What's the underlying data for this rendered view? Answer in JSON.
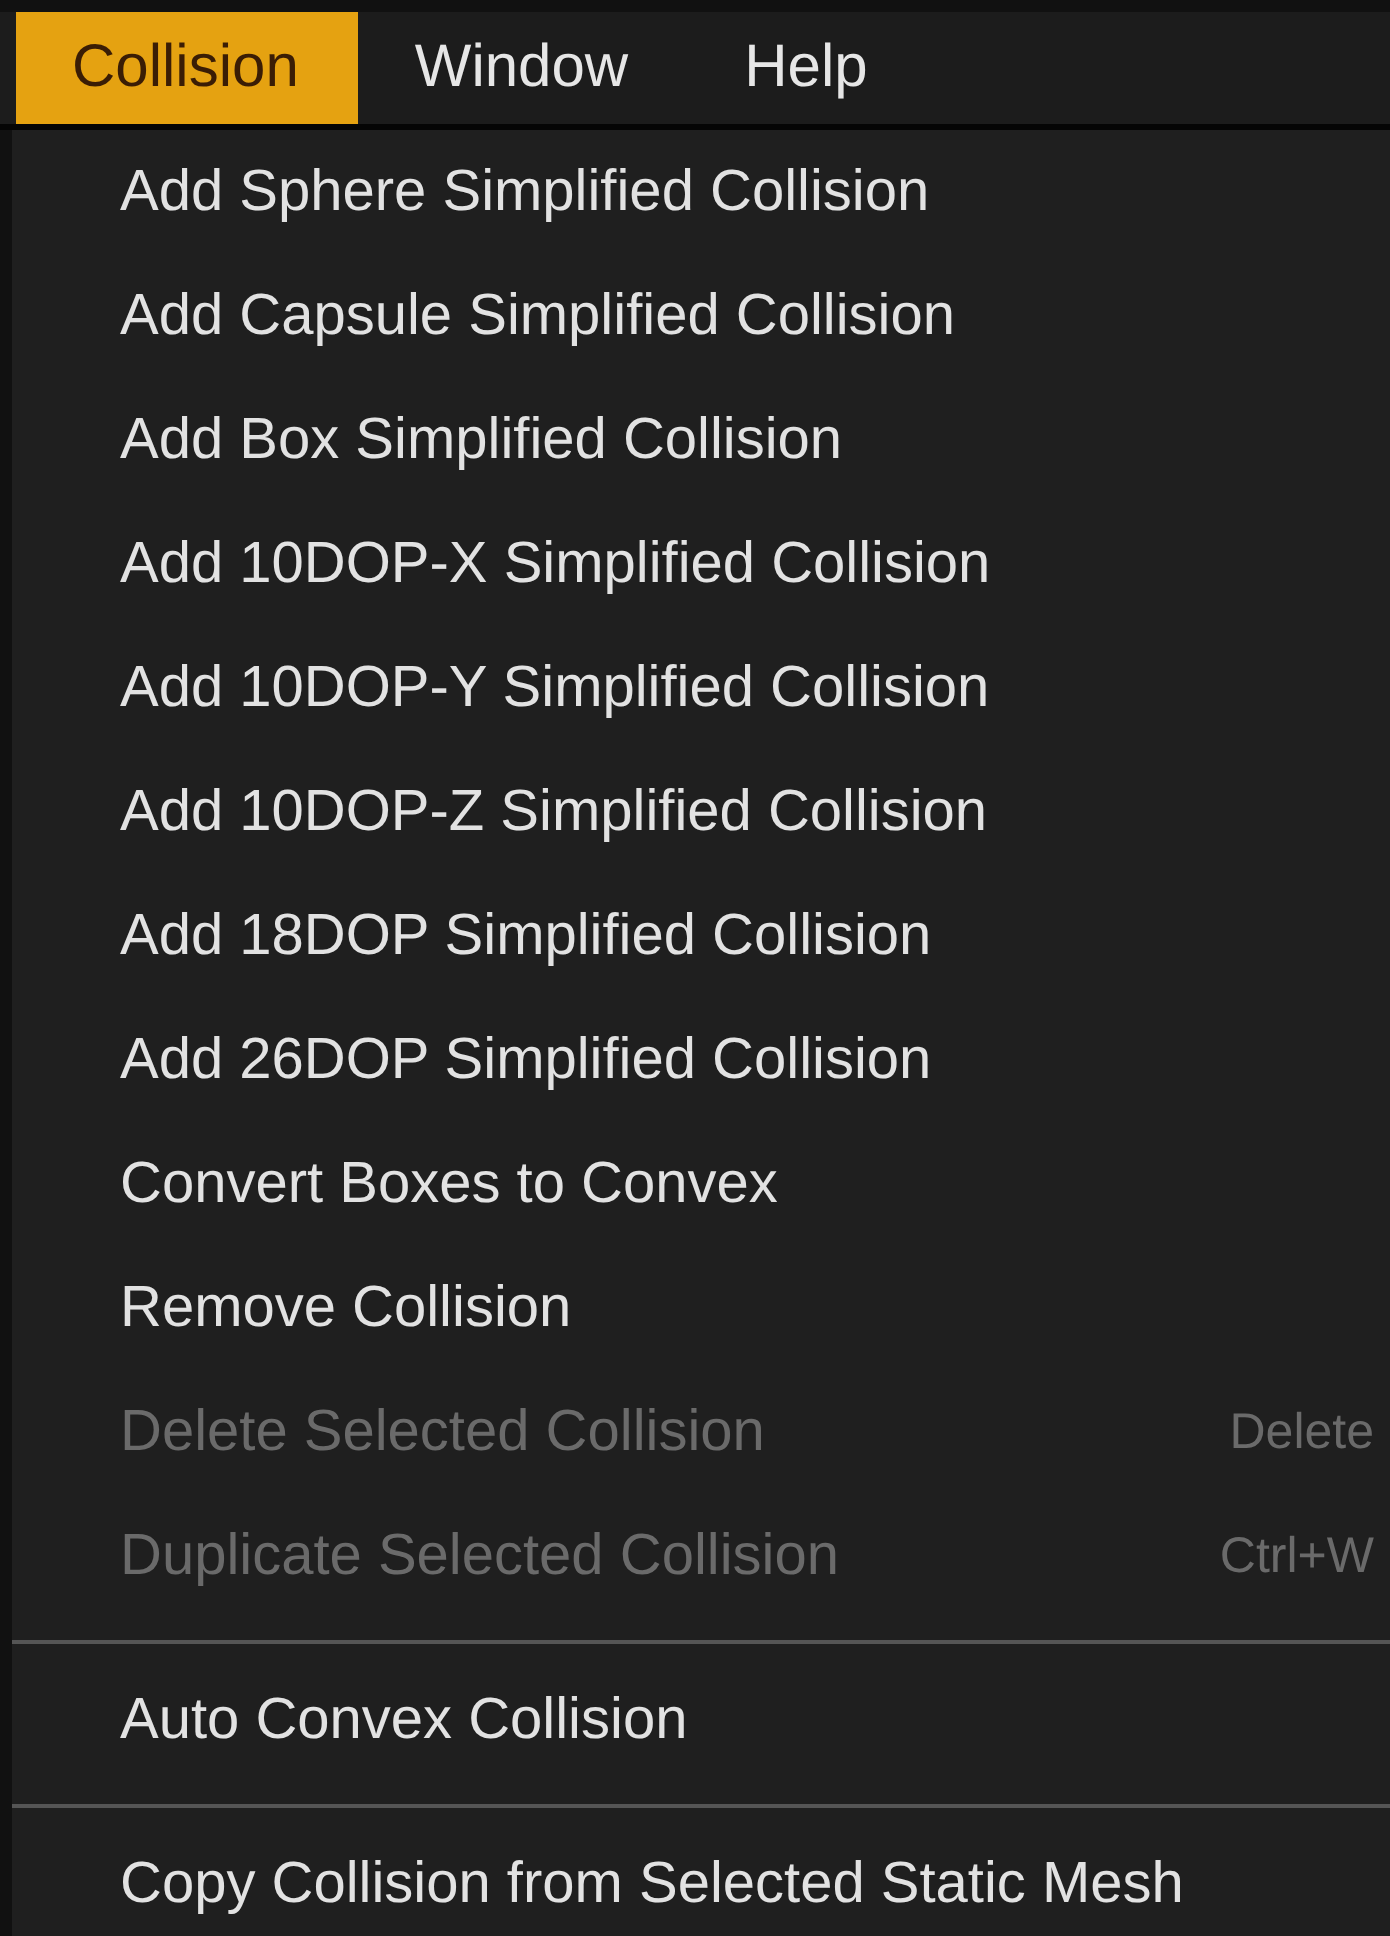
{
  "menubar": [
    {
      "label": "Collision",
      "selected": true
    },
    {
      "label": "Window",
      "selected": false
    },
    {
      "label": "Help",
      "selected": false
    }
  ],
  "menu": {
    "items": [
      {
        "kind": "item",
        "label": "Add Sphere Simplified Collision",
        "disabled": false
      },
      {
        "kind": "item",
        "label": "Add Capsule Simplified Collision",
        "disabled": false
      },
      {
        "kind": "item",
        "label": "Add Box Simplified Collision",
        "disabled": false
      },
      {
        "kind": "item",
        "label": "Add 10DOP-X Simplified Collision",
        "disabled": false
      },
      {
        "kind": "item",
        "label": "Add 10DOP-Y Simplified Collision",
        "disabled": false
      },
      {
        "kind": "item",
        "label": "Add 10DOP-Z Simplified Collision",
        "disabled": false
      },
      {
        "kind": "item",
        "label": "Add 18DOP Simplified Collision",
        "disabled": false
      },
      {
        "kind": "item",
        "label": "Add 26DOP Simplified Collision",
        "disabled": false
      },
      {
        "kind": "item",
        "label": "Convert Boxes to Convex",
        "disabled": false
      },
      {
        "kind": "item",
        "label": "Remove Collision",
        "disabled": false
      },
      {
        "kind": "item",
        "label": "Delete Selected Collision",
        "disabled": true,
        "shortcut": "Delete"
      },
      {
        "kind": "item",
        "label": "Duplicate Selected Collision",
        "disabled": true,
        "shortcut": "Ctrl+W"
      },
      {
        "kind": "separator"
      },
      {
        "kind": "item",
        "label": "Auto Convex Collision",
        "disabled": false
      },
      {
        "kind": "separator"
      },
      {
        "kind": "item",
        "label": "Copy Collision from Selected Static Mesh",
        "disabled": false
      }
    ]
  }
}
